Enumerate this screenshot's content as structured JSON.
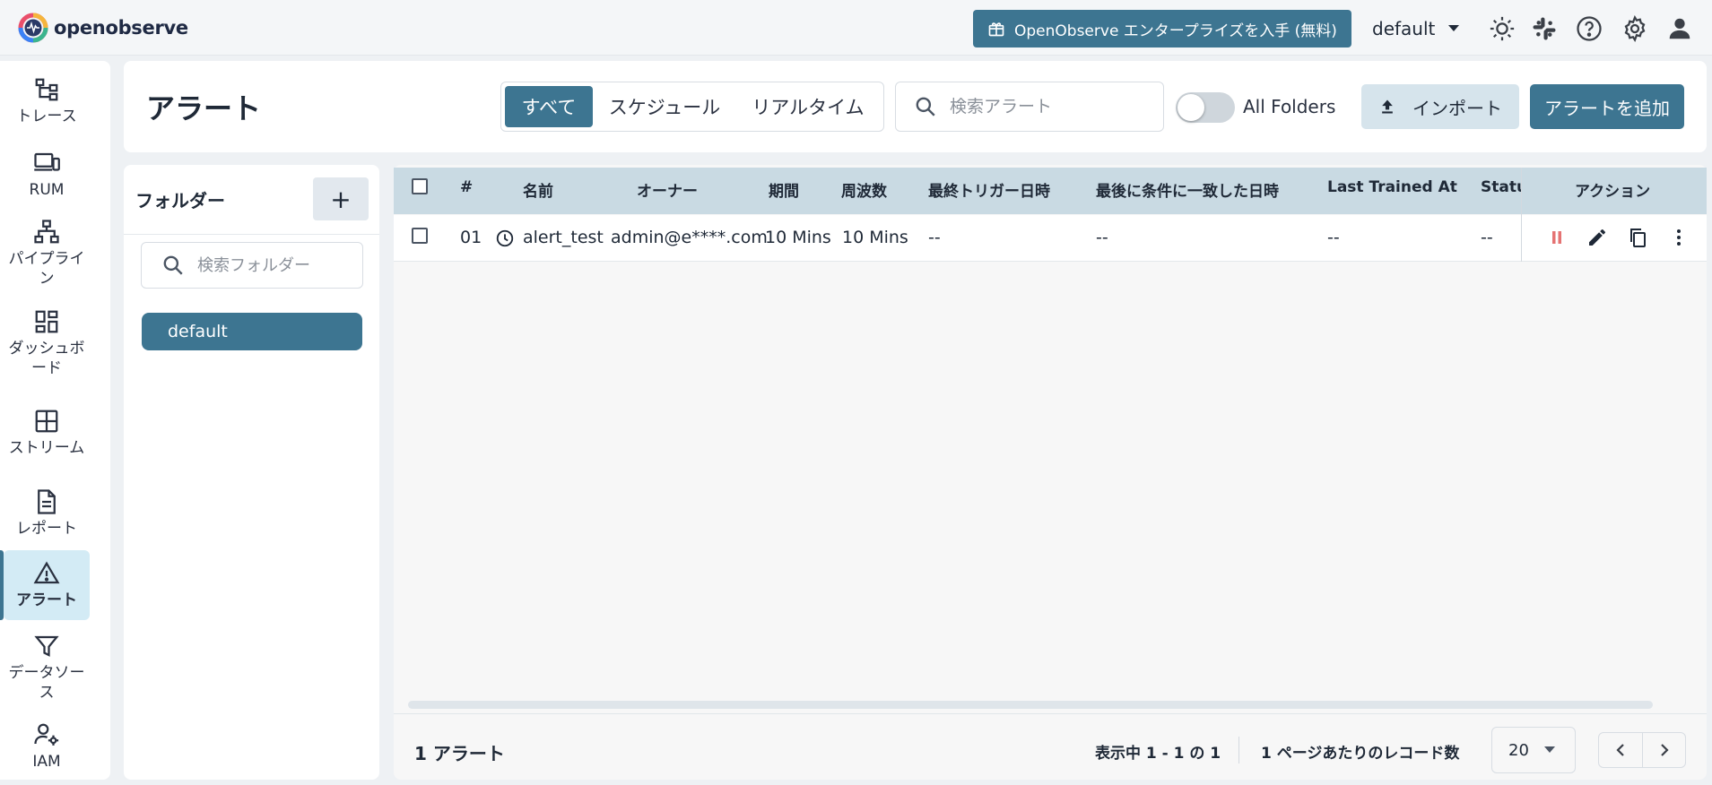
{
  "app": {
    "brand": "openobserve",
    "enterprise_label": "OpenObserve エンタープライズを入手 (無料)",
    "org": "default"
  },
  "sidebar": {
    "items": [
      {
        "label": "トレース"
      },
      {
        "label": "RUM"
      },
      {
        "label": "パイプライン"
      },
      {
        "label": "ダッシュボード"
      },
      {
        "label": "ストリーム"
      },
      {
        "label": "レポート"
      },
      {
        "label": "アラート"
      },
      {
        "label": "データソース"
      },
      {
        "label": "IAM"
      }
    ],
    "active": "アラート"
  },
  "header": {
    "title": "アラート",
    "tabs": [
      {
        "label": "すべて",
        "active": true
      },
      {
        "label": "スケジュール",
        "active": false
      },
      {
        "label": "リアルタイム",
        "active": false
      }
    ],
    "search_placeholder": "検索アラート",
    "all_folders_label": "All Folders",
    "all_folders_on": false,
    "import_label": "インポート",
    "add_label": "アラートを追加"
  },
  "folders": {
    "title": "フォルダー",
    "add_label": "+",
    "search_placeholder": "検索フォルダー",
    "items": [
      {
        "label": "default",
        "selected": true
      }
    ]
  },
  "table": {
    "columns": [
      "#",
      "名前",
      "オーナー",
      "期間",
      "周波数",
      "最終トリガー日時",
      "最後に条件に一致した日時",
      "Last Trained At",
      "Status",
      "アクション"
    ],
    "rows": [
      {
        "index": "01",
        "name": "alert_test",
        "owner": "admin@e****.com",
        "period": "10 Mins",
        "frequency": "10 Mins",
        "last_triggered": "--",
        "last_satisfied": "--",
        "last_trained": "--",
        "status": "--"
      }
    ]
  },
  "footer": {
    "count_label": "1 アラート",
    "range_label": "表示中 1 - 1 の 1",
    "rpp_label": "1 ページあたりのレコード数",
    "rpp_value": "20"
  },
  "colors": {
    "primary": "#3d7591",
    "header_row": "#c9dae3",
    "active_nav": "#d3ebf5",
    "pause": "#e57373"
  }
}
